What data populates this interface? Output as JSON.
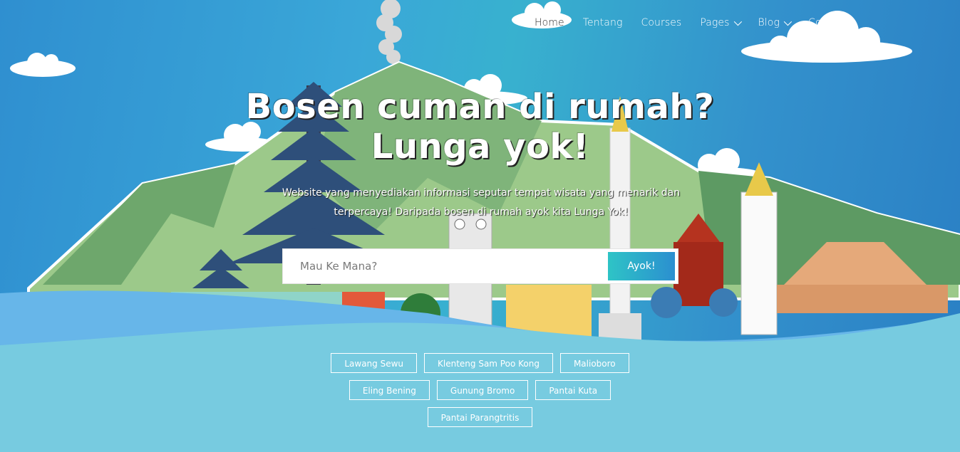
{
  "nav": {
    "items": [
      {
        "label": "Home",
        "dropdown": false
      },
      {
        "label": "Tentang",
        "dropdown": false
      },
      {
        "label": "Courses",
        "dropdown": false
      },
      {
        "label": "Pages",
        "dropdown": true
      },
      {
        "label": "Blog",
        "dropdown": true
      },
      {
        "label": "Contact",
        "dropdown": false
      }
    ]
  },
  "hero": {
    "title_line1": "Bosen cuman di rumah?",
    "title_line2": "Lunga yok!",
    "subtitle_line1": "Website yang menyediakan informasi seputar tempat wisata yang menarik dan",
    "subtitle_line2": "terpercaya! Daripada bosen di rumah ayok kita Lunga Yok!"
  },
  "search": {
    "placeholder": "Mau Ke Mana?",
    "value": "",
    "button_label": "Ayok!"
  },
  "tags": {
    "row1": [
      "Lawang Sewu",
      "Klenteng Sam Poo Kong",
      "Malioboro"
    ],
    "row2": [
      "Eling Bening",
      "Gunung Bromo",
      "Pantai Kuta"
    ],
    "row3": [
      "Pantai Parangtritis"
    ]
  },
  "colors": {
    "sky": "#2f8fd0",
    "water": "#77cbe0",
    "button_start": "#2ec4c6",
    "button_end": "#2b8fd0"
  }
}
